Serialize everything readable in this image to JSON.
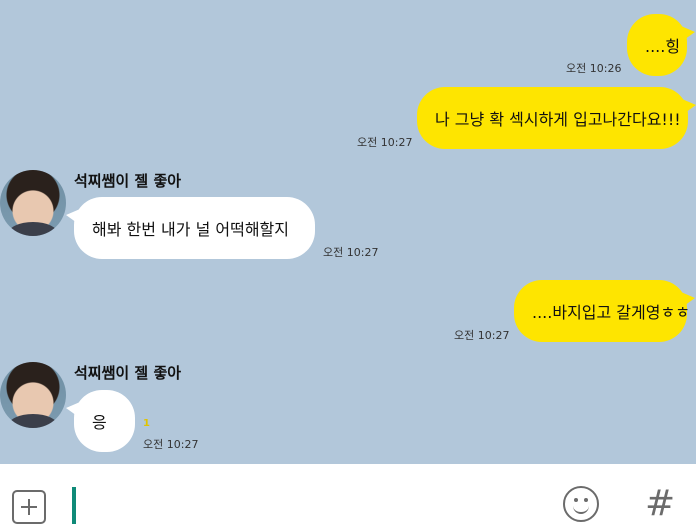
{
  "messages": [
    {
      "type": "me",
      "text": "....힝",
      "time": "오전 10:26"
    },
    {
      "type": "me",
      "text": "나 그냥 확 섹시하게 입고나간다요!!!",
      "time": "오전 10:27"
    },
    {
      "type": "you",
      "sender": "석찌쌤이 젤 좋아",
      "text": "해봐 한번 내가 널 어떡해할지",
      "time": "오전 10:27"
    },
    {
      "type": "me",
      "text": "....바지입고 갈게영ㅎㅎ",
      "time": "오전 10:27"
    },
    {
      "type": "you",
      "sender": "석찌쌤이 젤 좋아",
      "text": "응",
      "time": "오전 10:27",
      "unread": "1"
    }
  ],
  "input": {
    "icons": [
      "plus-icon",
      "emoji-icon",
      "hash-icon"
    ],
    "hash_label": "#"
  },
  "colors": {
    "chat_background": "#b2c7da",
    "my_bubble": "#fee500",
    "their_bubble": "#ffffff",
    "cursor": "#0f8a78"
  }
}
